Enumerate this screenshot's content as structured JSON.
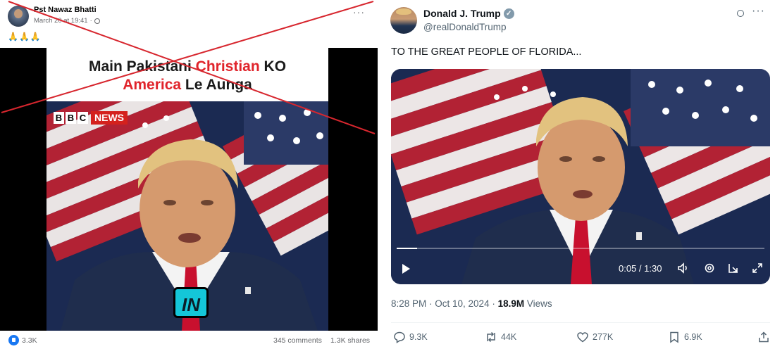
{
  "facebook_post": {
    "author": "Pst Nawaz Bhatti",
    "timestamp": "March 20 at 19:41",
    "privacy_icon": "globe-icon",
    "more_label": "···",
    "emoji_line": "🙏🙏🙏",
    "video": {
      "caption_line1_a": "Main Pakistani ",
      "caption_line1_red": "Christian",
      "caption_line1_b": " KO",
      "caption_line2_red": "America",
      "caption_line2_b": " Le Aunga",
      "bbc_letters": [
        "B",
        "B",
        "C"
      ],
      "bbc_news": "NEWS",
      "badge": "IN"
    },
    "likes": "3.3K",
    "comments": "345 comments",
    "shares": "1.3K shares",
    "cross_color": "#d7262e"
  },
  "tweet": {
    "name": "Donald J. Trump",
    "verified": "✓",
    "handle": "@realDonaldTrump",
    "more_label": "···",
    "text": "TO THE GREAT PEOPLE OF FLORIDA...",
    "video": {
      "time": "0:05 / 1:30",
      "progress": 0.055
    },
    "timestamp": "8:28 PM · Oct 10, 2024 · ",
    "views_count": "18.9M",
    "views_label": " Views",
    "actions": {
      "replies": "9.3K",
      "reposts": "44K",
      "likes": "277K",
      "bookmarks": "6.9K"
    }
  },
  "colors": {
    "fb_blue": "#1877f2",
    "x_text_secondary": "#536471",
    "news_red": "#d4211d",
    "flag_red": "#b22234",
    "flag_blue": "#2b3a67",
    "suit_navy": "#1f2d4d",
    "tie_red": "#c8102e"
  }
}
